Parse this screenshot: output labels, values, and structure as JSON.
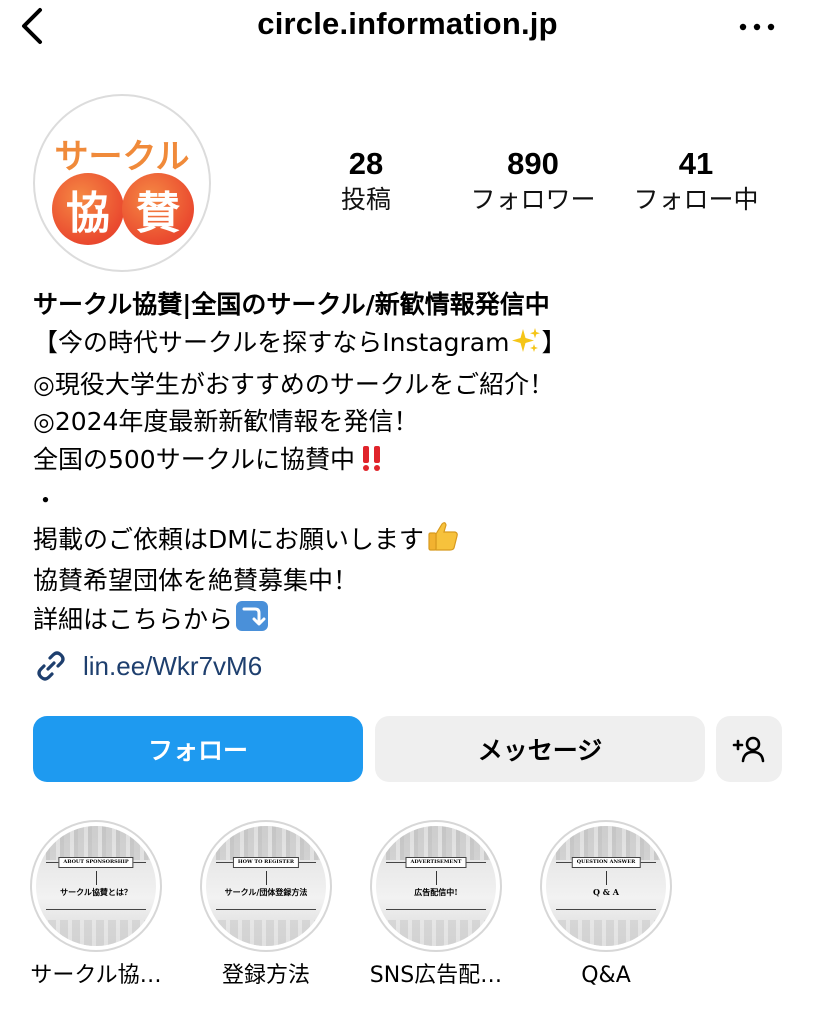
{
  "header": {
    "handle": "circle.information.jp",
    "back_icon": "chevron-left-icon",
    "more_icon": "more-horizontal-icon"
  },
  "avatar": {
    "top_text": "サークル",
    "circle_chars": [
      "協",
      "賛"
    ],
    "accent_color": "#f08a3a",
    "circle_color": "#ea4a2f"
  },
  "stats": [
    {
      "value": "28",
      "label": "投稿"
    },
    {
      "value": "890",
      "label": "フォロワー"
    },
    {
      "value": "41",
      "label": "フォロー中"
    }
  ],
  "bio": {
    "name": "サークル協賛|全国のサークル/新歓情報発信中",
    "lines": [
      "【今の時代サークルを探すならInstagram",
      "】",
      "◎現役大学生がおすすめのサークルをご紹介！",
      "◎2024年度最新新歓情報を発信！",
      "全国の500サークルに協賛中",
      "・",
      "掲載のご依頼はDMにお願いします",
      "協賛希望団体を絶賛募集中！",
      "詳細はこちらから"
    ]
  },
  "link": {
    "text": "lin.ee/Wkr7vM6",
    "icon": "link-icon",
    "color": "#1e3f6e"
  },
  "actions": {
    "follow_label": "フォロー",
    "message_label": "メッセージ",
    "add_user_icon": "add-user-icon",
    "follow_color": "#1e9af0"
  },
  "highlights": [
    {
      "label": "サークル協…",
      "cover_tag": "ABOUT SPONSORSHIP",
      "cover_title": "サークル協賛とは？"
    },
    {
      "label": "登録方法",
      "cover_tag": "HOW TO REGISTER",
      "cover_title": "サークル/団体登録方法"
    },
    {
      "label": "SNS広告配…",
      "cover_tag": "ADVERTISEMENT",
      "cover_title": "広告配信中!"
    },
    {
      "label": "Q&A",
      "cover_tag": "QUESTION ANSWER",
      "cover_title": "Q & A"
    }
  ]
}
